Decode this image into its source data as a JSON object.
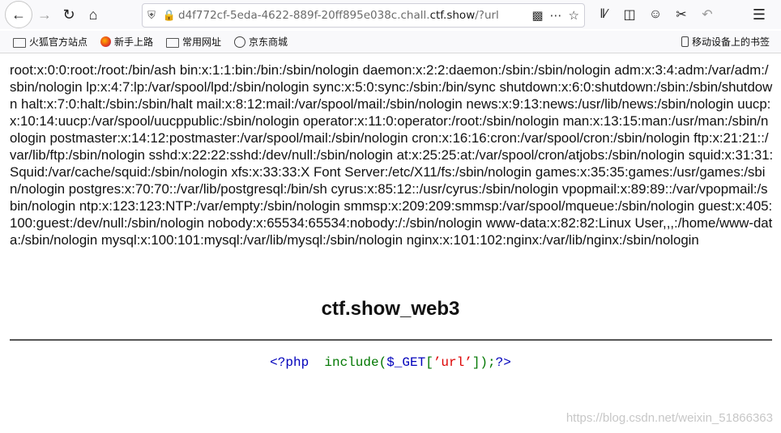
{
  "browser": {
    "url_prefix": "d4f772cf-5eda-4622-889f-20ff895e038c.chall.",
    "url_host": "ctf.show",
    "url_suffix": "/?url=",
    "icons": [
      "back-icon",
      "forward-icon",
      "reload-icon",
      "home-icon",
      "shield-icon",
      "insecure-lock-icon",
      "qr-code-icon",
      "more-icon",
      "bookmark-star-icon",
      "library-icon",
      "sidebar-icon",
      "account-icon",
      "screenshot-icon",
      "undo-icon",
      "menu-icon"
    ]
  },
  "bookmarks": {
    "items": [
      {
        "label": "火狐官方站点",
        "icon": "folder-icon"
      },
      {
        "label": "新手上路",
        "icon": "firefox-icon"
      },
      {
        "label": "常用网址",
        "icon": "folder-icon"
      },
      {
        "label": "京东商城",
        "icon": "globe-icon"
      }
    ],
    "mobile_label": "移动设备上的书签"
  },
  "page": {
    "passwd": "root:x:0:0:root:/root:/bin/ash bin:x:1:1:bin:/bin:/sbin/nologin daemon:x:2:2:daemon:/sbin:/sbin/nologin adm:x:3:4:adm:/var/adm:/sbin/nologin lp:x:4:7:lp:/var/spool/lpd:/sbin/nologin sync:x:5:0:sync:/sbin:/bin/sync shutdown:x:6:0:shutdown:/sbin:/sbin/shutdown halt:x:7:0:halt:/sbin:/sbin/halt mail:x:8:12:mail:/var/spool/mail:/sbin/nologin news:x:9:13:news:/usr/lib/news:/sbin/nologin uucp:x:10:14:uucp:/var/spool/uucppublic:/sbin/nologin operator:x:11:0:operator:/root:/sbin/nologin man:x:13:15:man:/usr/man:/sbin/nologin postmaster:x:14:12:postmaster:/var/spool/mail:/sbin/nologin cron:x:16:16:cron:/var/spool/cron:/sbin/nologin ftp:x:21:21::/var/lib/ftp:/sbin/nologin sshd:x:22:22:sshd:/dev/null:/sbin/nologin at:x:25:25:at:/var/spool/cron/atjobs:/sbin/nologin squid:x:31:31:Squid:/var/cache/squid:/sbin/nologin xfs:x:33:33:X Font Server:/etc/X11/fs:/sbin/nologin games:x:35:35:games:/usr/games:/sbin/nologin postgres:x:70:70::/var/lib/postgresql:/bin/sh cyrus:x:85:12::/usr/cyrus:/sbin/nologin vpopmail:x:89:89::/var/vpopmail:/sbin/nologin ntp:x:123:123:NTP:/var/empty:/sbin/nologin smmsp:x:209:209:smmsp:/var/spool/mqueue:/sbin/nologin guest:x:405:100:guest:/dev/null:/sbin/nologin nobody:x:65534:65534:nobody:/:/sbin/nologin www-data:x:82:82:Linux User,,,:/home/www-data:/sbin/nologin mysql:x:100:101:mysql:/var/lib/mysql:/sbin/nologin nginx:x:101:102:nginx:/var/lib/nginx:/sbin/nologin",
    "title": "ctf.show_web3",
    "code": {
      "open_tag": "<?php",
      "keyword": "include(",
      "var": "$_GET",
      "bracket_open": "[",
      "string": "’url’",
      "bracket_close": "]);",
      "close_tag": "?>"
    },
    "watermark": "https://blog.csdn.net/weixin_51866363"
  }
}
